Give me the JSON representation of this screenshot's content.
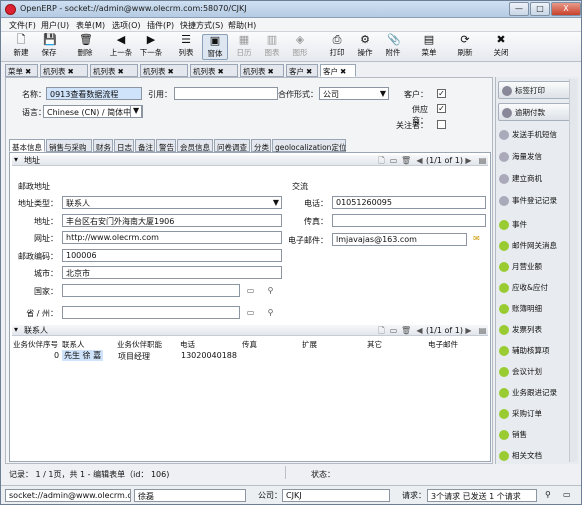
{
  "window": {
    "title": "OpenERP - socket://admin@www.olecrm.com:58070/CJKJ",
    "min": "—",
    "max": "□",
    "close": "X"
  },
  "menu": [
    "文件(F)",
    "用户(U)",
    "表单(M)",
    "选项(O)",
    "插件(P)",
    "快捷方式(S)",
    "帮助(H)"
  ],
  "toolbar": [
    "新建",
    "保存",
    "删除",
    "上一条",
    "下一条",
    "列表",
    "窗体",
    "日历",
    "图表",
    "图形",
    "打印",
    "操作",
    "附件",
    "菜单",
    "刷新",
    "关闭"
  ],
  "doc_tabs": [
    "菜单",
    "机列表",
    "机列表",
    "机列表",
    "机列表",
    "机列表",
    "客户",
    "客户"
  ],
  "form": {
    "name_label": "名称：",
    "name_value": "0913查看数据流程",
    "ref_label": "引用：",
    "ref_value": "",
    "partnership_label": "合作形式：",
    "partnership_value": "公司",
    "lang_label": "语言：",
    "lang_value": "Chinese (CN) / 简体中文",
    "customer_label": "客户：",
    "supplier_label": "供应商：",
    "follower_label": "关注者：",
    "customer_checked": "✓",
    "supplier_checked": "✓"
  },
  "notebook_tabs": [
    "基本信息",
    "销售与采购",
    "财务",
    "日志",
    "备注",
    "警告",
    "会员信息",
    "问卷调查",
    "分类",
    "geolocalization定位"
  ],
  "address": {
    "section_title": "地址",
    "pager": "(1/1 of 1)",
    "postal_group": "邮政地址",
    "contact_group": "交流",
    "type_label": "地址类型：",
    "type_value": "联系人",
    "street_label": "地址：",
    "street_value": "丰台区右安门外海南大厦1906",
    "web_label": "网址：",
    "web_value": "http://www.olecrm.com",
    "zip_label": "邮政编码：",
    "zip_value": "100006",
    "city_label": "城市：",
    "city_value": "北京市",
    "country_label": "国家：",
    "country_value": "",
    "state_label": "省 / 州：",
    "state_value": "",
    "phone_label": "电话：",
    "phone_value": "01051260095",
    "fax_label": "传真：",
    "fax_value": "",
    "email_label": "电子邮件：",
    "email_value": "lmjavajas@163.com"
  },
  "contacts": {
    "section_title": "联系人",
    "pager": "(1/1 of 1)",
    "columns": [
      "业务伙伴序号",
      "联系人",
      "业务伙伴职能",
      "电话",
      "传真",
      "扩展",
      "其它",
      "电子邮件"
    ],
    "rows": [
      {
        "seq": "0",
        "name": "先生 徐 嘉",
        "function": "项目经理",
        "phone": "13020040188",
        "fax": "",
        "ext": "",
        "other": "",
        "email": ""
      }
    ]
  },
  "sidebar": {
    "buttons": [
      "标签打印",
      "逾期付款"
    ],
    "items": [
      "发送手机短信",
      "海量发信",
      "建立商机",
      "事件登记记录"
    ],
    "actions": [
      "事件",
      "邮件网关消息",
      "月营业额",
      "应收&应付",
      "账簿明细",
      "发票列表",
      "辅助核算项",
      "会议计划",
      "业务跟进记录",
      "采购订单",
      "销售",
      "相关文档"
    ]
  },
  "record_status": {
    "text": "记录： 1 / 1页，共 1 - 编辑表单（id： 106)",
    "state_label": "状态："
  },
  "statusbar": {
    "server": "socket://admin@www.olecrm.com",
    "user": "徐磊",
    "company_label": "公司：",
    "company": "CJKJ",
    "request_label": "请求：",
    "request": "3个请求 已发送 1 个请求"
  }
}
